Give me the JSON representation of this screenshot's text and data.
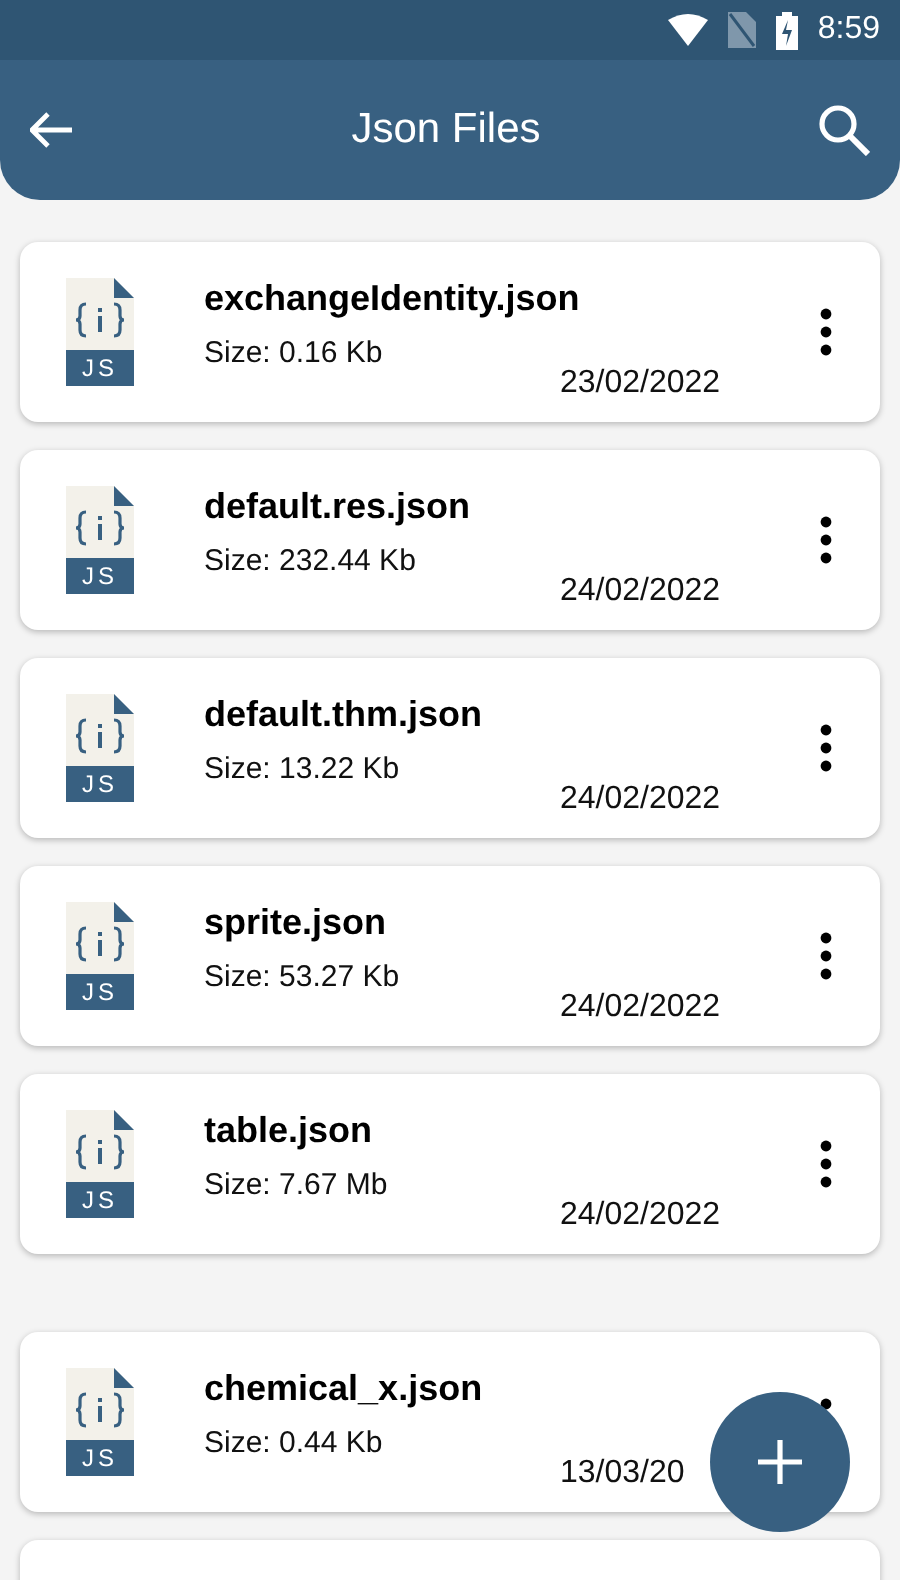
{
  "status_bar": {
    "time": "8:59"
  },
  "app_bar": {
    "title": "Json Files"
  },
  "groups": [
    [
      {
        "name": "exchangeIdentity.json",
        "size": "Size: 0.16 Kb",
        "date": "23/02/2022",
        "badge": "JS"
      },
      {
        "name": "default.res.json",
        "size": "Size: 232.44 Kb",
        "date": "24/02/2022",
        "badge": "JS"
      },
      {
        "name": "default.thm.json",
        "size": "Size: 13.22 Kb",
        "date": "24/02/2022",
        "badge": "JS"
      },
      {
        "name": "sprite.json",
        "size": "Size: 53.27 Kb",
        "date": "24/02/2022",
        "badge": "JS"
      },
      {
        "name": "table.json",
        "size": "Size: 7.67 Mb",
        "date": "24/02/2022",
        "badge": "JS"
      }
    ],
    [
      {
        "name": "chemical_x.json",
        "size": "Size: 0.44 Kb",
        "date": "13/03/20",
        "badge": "JS"
      }
    ]
  ]
}
